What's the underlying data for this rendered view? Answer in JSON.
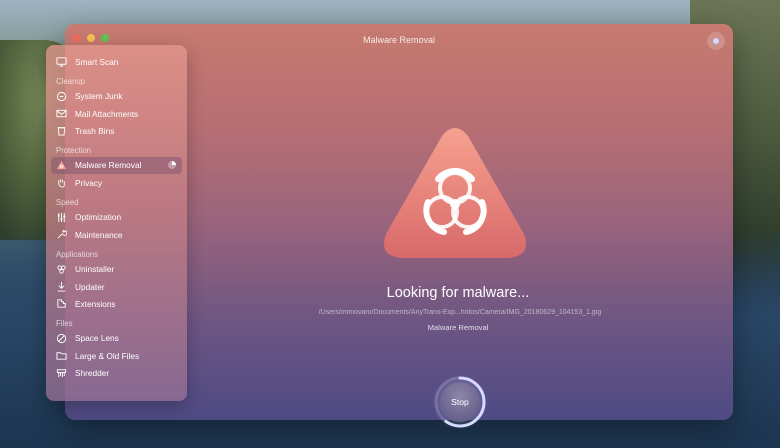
{
  "window": {
    "title": "Malware Removal"
  },
  "sidebar": {
    "groups": [
      {
        "label": "",
        "items": [
          {
            "label": "Smart Scan",
            "icon": "monitor-icon"
          }
        ]
      },
      {
        "label": "Cleanup",
        "items": [
          {
            "label": "System Junk",
            "icon": "trash-bin-icon"
          },
          {
            "label": "Mail Attachments",
            "icon": "envelope-icon"
          },
          {
            "label": "Trash Bins",
            "icon": "bin-icon"
          }
        ]
      },
      {
        "label": "Protection",
        "items": [
          {
            "label": "Malware Removal",
            "icon": "biohazard-icon",
            "active": true
          },
          {
            "label": "Privacy",
            "icon": "hand-icon"
          }
        ]
      },
      {
        "label": "Speed",
        "items": [
          {
            "label": "Optimization",
            "icon": "sliders-icon"
          },
          {
            "label": "Maintenance",
            "icon": "wrench-icon"
          }
        ]
      },
      {
        "label": "Applications",
        "items": [
          {
            "label": "Uninstaller",
            "icon": "apps-icon"
          },
          {
            "label": "Updater",
            "icon": "updater-icon"
          },
          {
            "label": "Extensions",
            "icon": "extension-icon"
          }
        ]
      },
      {
        "label": "Files",
        "items": [
          {
            "label": "Space Lens",
            "icon": "lens-icon"
          },
          {
            "label": "Large & Old Files",
            "icon": "folder-icon"
          },
          {
            "label": "Shredder",
            "icon": "shredder-icon"
          }
        ]
      }
    ],
    "active_progress": 0.25
  },
  "scan": {
    "title": "Looking for malware...",
    "current_path": "/Users/immovaro/Documents/AnyTrans-Exp...hotos/Camera/IMG_20180629_104153_1.jpg",
    "module": "Malware Removal",
    "stop_label": "Stop",
    "progress": 0.6
  },
  "colors": {
    "accent": "#f09a92",
    "window_top": "#c67a70",
    "window_bottom": "#4e4a84"
  }
}
